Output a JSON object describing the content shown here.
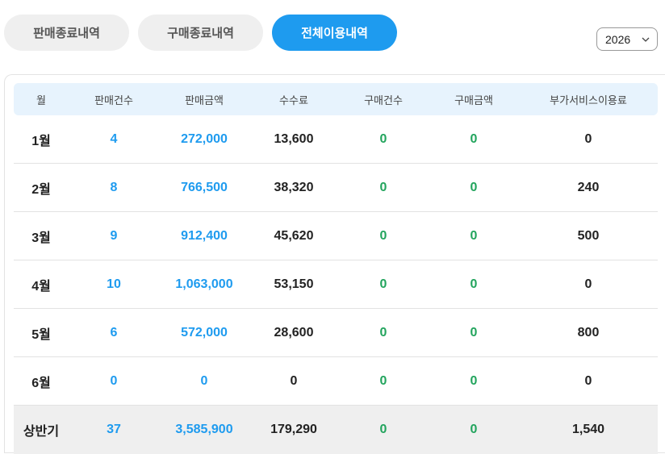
{
  "tabs": [
    {
      "label": "판매종료내역",
      "active": false
    },
    {
      "label": "구매종료내역",
      "active": false
    },
    {
      "label": "전체이용내역",
      "active": true
    }
  ],
  "year_select": {
    "value": "2026"
  },
  "table": {
    "headers": [
      "월",
      "판매건수",
      "판매금액",
      "수수료",
      "구매건수",
      "구매금액",
      "부가서비스이용료"
    ],
    "rows": [
      [
        "1월",
        "4",
        "272,000",
        "13,600",
        "0",
        "0",
        "0"
      ],
      [
        "2월",
        "8",
        "766,500",
        "38,320",
        "0",
        "0",
        "240"
      ],
      [
        "3월",
        "9",
        "912,400",
        "45,620",
        "0",
        "0",
        "500"
      ],
      [
        "4월",
        "10",
        "1,063,000",
        "53,150",
        "0",
        "0",
        "0"
      ],
      [
        "5월",
        "6",
        "572,000",
        "28,600",
        "0",
        "0",
        "800"
      ],
      [
        "6월",
        "0",
        "0",
        "0",
        "0",
        "0",
        "0"
      ]
    ],
    "total": [
      "상반기",
      "37",
      "3,585,900",
      "179,290",
      "0",
      "0",
      "1,540"
    ]
  },
  "colors": {
    "accent": "#1e9bef",
    "green": "#22a45d",
    "header_bg": "#e7f3fd",
    "total_bg": "#efefef"
  }
}
